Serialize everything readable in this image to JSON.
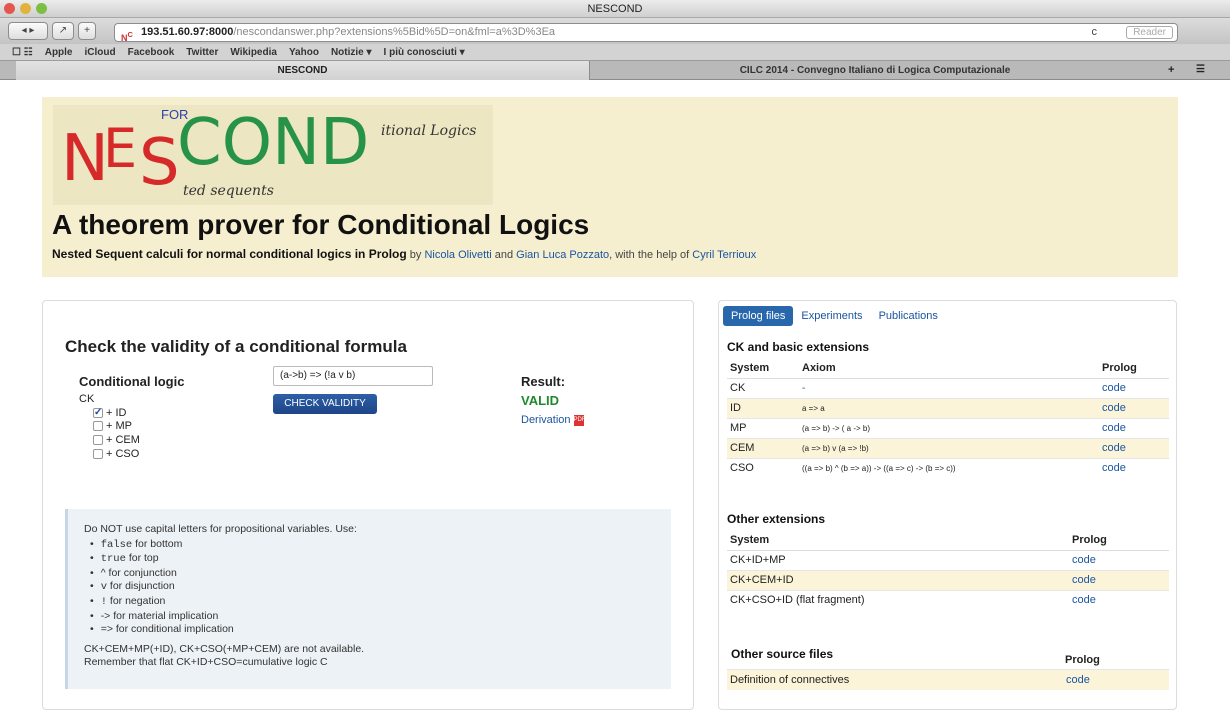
{
  "window": {
    "title": "NESCOND",
    "url_host": "193.51.60.97:8000",
    "url_rest": "/nescondanswer.php?extensions%5Bid%5D=on&fml=a%3D%3Ea",
    "reader_label": "Reader",
    "reload_glyph": "c"
  },
  "bookmarks": [
    "Apple",
    "iCloud",
    "Facebook",
    "Twitter",
    "Wikipedia",
    "Yahoo",
    "Notizie ▾",
    "I più conosciuti ▾"
  ],
  "tabs": {
    "active": "NESCOND",
    "other": "CILC 2014 - Convegno Italiano di Logica Computazionale"
  },
  "header": {
    "logo": {
      "for": "FOR",
      "n": "N",
      "e": "E",
      "s": "S",
      "cond": "COND",
      "itional": "itional Logics",
      "ted": "ted sequents"
    },
    "title": "A theorem prover for Conditional Logics",
    "subtitle_bold": "Nested Sequent calculi for normal conditional logics in Prolog",
    "by": " by ",
    "author1": "Nicola Olivetti",
    "and": " and ",
    "author2": "Gian Luca Pozzato",
    "help": ", with the help of ",
    "author3": "Cyril Terrioux"
  },
  "left": {
    "title": "Check the validity of a conditional formula",
    "logic_label": "Conditional logic",
    "ck": "CK",
    "options": [
      {
        "label": "+ ID",
        "checked": true
      },
      {
        "label": "+ MP",
        "checked": false
      },
      {
        "label": "+ CEM",
        "checked": false
      },
      {
        "label": "+ CSO",
        "checked": false
      }
    ],
    "formula_value": "(a->b) => (!a v b)",
    "check_button": "CHECK VALIDITY",
    "result_label": "Result:",
    "result_value": "VALID",
    "derivation": "Derivation",
    "hint": {
      "intro": "Do NOT use capital letters for propositional variables. Use:",
      "items": [
        {
          "sym": "false",
          "text": " for bottom"
        },
        {
          "sym": "true",
          "text": " for top"
        },
        {
          "sym": "^",
          "text": " for conjunction"
        },
        {
          "sym": "v",
          "text": " for disjunction"
        },
        {
          "sym": "!",
          "text": " for negation"
        },
        {
          "sym": "->",
          "text": " for material implication"
        },
        {
          "sym": "=>",
          "text": " for conditional implication"
        }
      ],
      "note1": "CK+CEM+MP(+ID), CK+CSO(+MP+CEM) are not available.",
      "note2": "Remember that flat CK+ID+CSO=cumulative logic C"
    }
  },
  "right": {
    "tabs": [
      "Prolog files",
      "Experiments",
      "Publications"
    ],
    "sec1": "CK and basic extensions",
    "t1_headers": [
      "System",
      "Axiom",
      "Prolog"
    ],
    "t1_rows": [
      {
        "system": "CK",
        "axiom": "-",
        "prolog": "code"
      },
      {
        "system": "ID",
        "axiom": "a => a",
        "prolog": "code"
      },
      {
        "system": "MP",
        "axiom": "(a => b) -> ( a -> b)",
        "prolog": "code"
      },
      {
        "system": "CEM",
        "axiom": "(a => b) v (a => !b)",
        "prolog": "code"
      },
      {
        "system": "CSO",
        "axiom": "((a => b) ^ (b => a)) -> ((a => c) -> (b => c))",
        "prolog": "code"
      }
    ],
    "sec2": "Other extensions",
    "t2_headers": [
      "System",
      "Prolog"
    ],
    "t2_rows": [
      {
        "system": "CK+ID+MP",
        "prolog": "code"
      },
      {
        "system": "CK+CEM+ID",
        "prolog": "code"
      },
      {
        "system": "CK+CSO+ID (flat fragment)",
        "prolog": "code"
      }
    ],
    "sec3": "Other source files",
    "t3_header_prolog": "Prolog",
    "t3_rows": [
      {
        "system": "Definition of connectives",
        "prolog": "code"
      }
    ]
  }
}
